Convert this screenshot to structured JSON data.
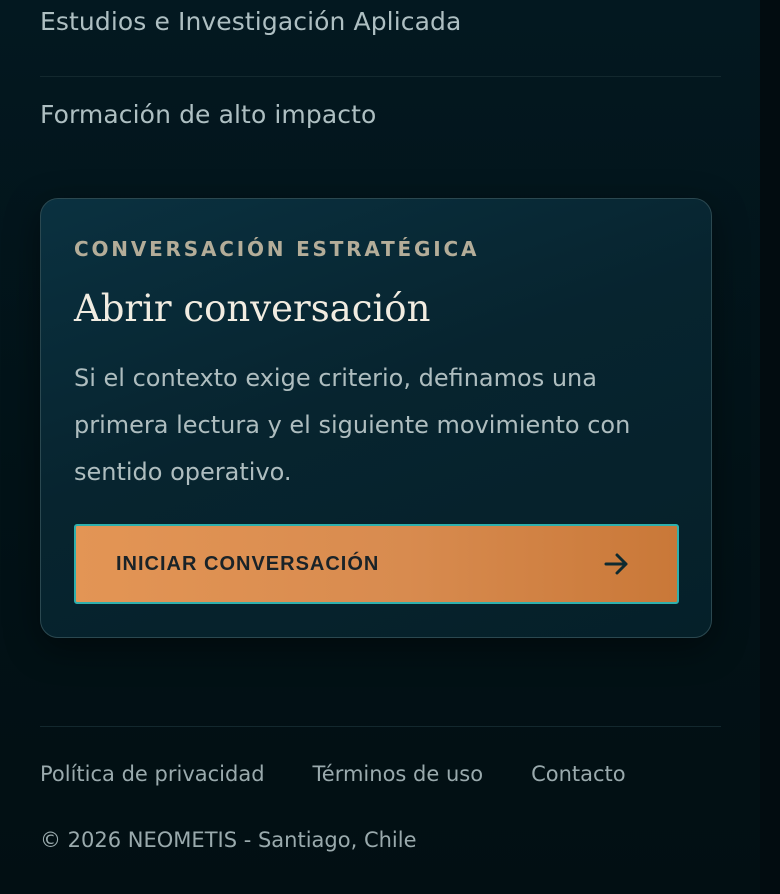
{
  "nav": {
    "items": [
      {
        "label": "Estudios e Investigación Aplicada"
      },
      {
        "label": "Formación de alto impacto"
      }
    ]
  },
  "card": {
    "eyebrow": "CONVERSACIÓN ESTRATÉGICA",
    "title": "Abrir conversación",
    "body": "Si el contexto exige criterio, definamos una primera lectura y el siguiente movimiento con sentido operativo.",
    "cta": {
      "label": "INICIAR CONVERSACIÓN",
      "icon": "arrow-right-icon"
    }
  },
  "footer": {
    "links": [
      {
        "label": "Política de privacidad"
      },
      {
        "label": "Términos de uso"
      },
      {
        "label": "Contacto"
      }
    ],
    "copyright": "© 2026 NEOMETIS - Santiago, Chile"
  },
  "colors": {
    "background": "#021217",
    "accent": "#e39555",
    "accent_border": "#2fb0ad",
    "text_muted": "#aebfc2",
    "title": "#f1ece1"
  }
}
